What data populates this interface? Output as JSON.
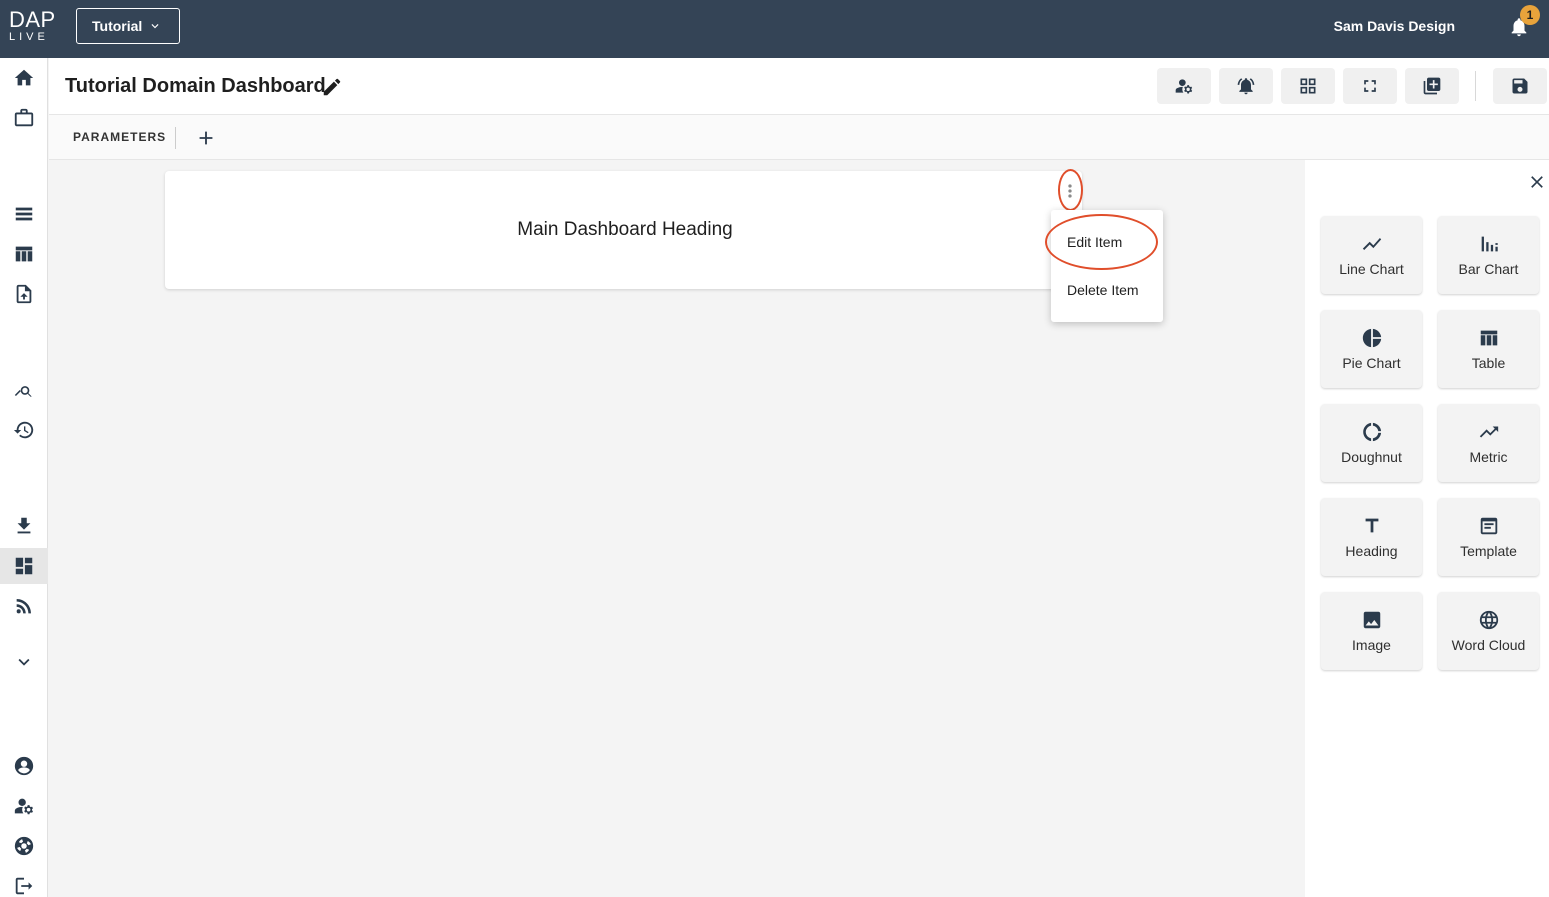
{
  "topbar": {
    "logo_top": "DAP",
    "logo_bottom": "LIVE",
    "domain_selected": "Tutorial",
    "user_name": "Sam Davis Design",
    "notification_count": "1",
    "background": "#344456",
    "badge_color": "#e8a33b"
  },
  "sidebar": {
    "items": [
      "home-icon",
      "briefcase-icon",
      "list-icon",
      "table-icon",
      "upload-file-icon",
      "query-stats-icon",
      "history-icon",
      "download-icon",
      "dashboard-icon",
      "rss-feed-icon",
      "expand-more-icon",
      "account-circle-icon",
      "manage-accounts-icon",
      "support-icon",
      "logout-icon"
    ],
    "active": "dashboard-icon"
  },
  "header": {
    "title": "Tutorial Domain Dashboard",
    "toolbar": [
      "manage-accounts-icon",
      "alarm-icon",
      "grid-view-icon",
      "fullscreen-icon",
      "add-to-queue-icon",
      "save-icon"
    ]
  },
  "parameters": {
    "label": "PARAMETERS"
  },
  "card": {
    "heading": "Main Dashboard Heading"
  },
  "context_menu": {
    "items": [
      "Edit Item",
      "Delete Item"
    ],
    "highlight_color": "#e04e2b"
  },
  "widget_panel": {
    "widgets": [
      {
        "label": "Line Chart",
        "icon": "line-chart-icon"
      },
      {
        "label": "Bar Chart",
        "icon": "bar-chart-icon"
      },
      {
        "label": "Pie Chart",
        "icon": "pie-chart-icon"
      },
      {
        "label": "Table",
        "icon": "table-icon"
      },
      {
        "label": "Doughnut",
        "icon": "doughnut-icon"
      },
      {
        "label": "Metric",
        "icon": "metric-icon"
      },
      {
        "label": "Heading",
        "icon": "heading-icon"
      },
      {
        "label": "Template",
        "icon": "template-icon"
      },
      {
        "label": "Image",
        "icon": "image-icon"
      },
      {
        "label": "Word Cloud",
        "icon": "word-cloud-icon"
      }
    ]
  }
}
